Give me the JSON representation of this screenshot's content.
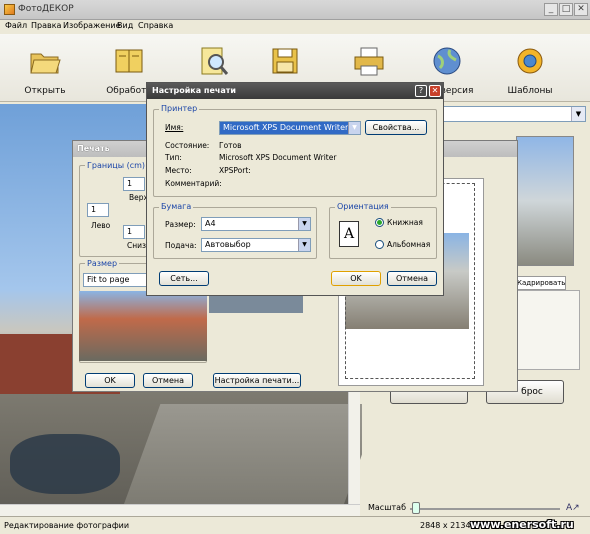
{
  "window": {
    "title": "ФотоДЕКОР",
    "min": "_",
    "max": "□",
    "close": "✕"
  },
  "menu": [
    "Файл",
    "Правка",
    "Изображение",
    "Вид",
    "Справка"
  ],
  "toolbar": [
    {
      "label": "Открыть",
      "icon": "folder-open-icon"
    },
    {
      "label": "Обработк",
      "icon": "book-icon"
    },
    {
      "label": "",
      "icon": "search-document-icon"
    },
    {
      "label": "",
      "icon": "floppy-disk-icon"
    },
    {
      "label": "",
      "icon": "printer-icon"
    },
    {
      "label": "версия",
      "icon": "globe-icon"
    },
    {
      "label": "Шаблоны",
      "icon": "templates-icon"
    }
  ],
  "right_panel": {
    "select_tail": "е",
    "tab_crop": "Кадрировать",
    "reset_tail": "брос"
  },
  "zoom": {
    "label": "Масштаб"
  },
  "status": {
    "text": "Редактирование фотографии",
    "dims": "2848 x 2134"
  },
  "watermark": "www.enersoft.ru",
  "print": {
    "title": "Печать",
    "margins_label": "Границы (cm)",
    "top_label": "Верх",
    "left_label": "Лево",
    "bottom_label": "Снизу",
    "top_value": "1",
    "left_value": "1",
    "bottom_value": "1",
    "size_label": "Размер",
    "size_value": "Fit to page",
    "ok": "OK",
    "cancel": "Отмена",
    "setup": "Настройка печати..."
  },
  "dialog": {
    "title": "Настройка печати",
    "help": "?",
    "close": "✕",
    "printer_group": "Принтер",
    "name_label": "Имя:",
    "name_value": "Microsoft XPS Document Writer",
    "properties": "Свойства...",
    "state_label": "Состояние:",
    "state_value": "Готов",
    "type_label": "Тип:",
    "type_value": "Microsoft XPS Document Writer",
    "place_label": "Место:",
    "place_value": "XPSPort:",
    "comment_label": "Комментарий:",
    "paper_group": "Бумага",
    "size_label": "Размер:",
    "size_value": "A4",
    "feed_label": "Подача:",
    "feed_value": "Автовыбор",
    "orient_group": "Ориентация",
    "portrait": "Книжная",
    "landscape": "Альбомная",
    "orient_glyph": "A",
    "network": "Сеть...",
    "ok": "OK",
    "cancel": "Отмена"
  },
  "colors": {
    "accent": "#1c46a8",
    "title_dark": "#3a3a3a",
    "close_red": "#c8402a"
  }
}
